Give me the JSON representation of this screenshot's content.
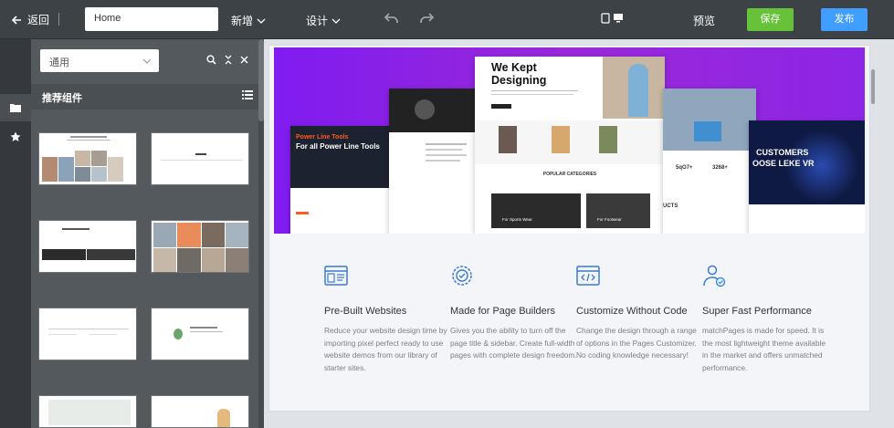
{
  "topbar": {
    "back_label": "返回",
    "page_value": "Home",
    "menu_add": "新增",
    "menu_design": "设计",
    "preview": "预览",
    "save": "保存",
    "publish": "发布"
  },
  "panel": {
    "select_value": "通用",
    "heading": "推荐组件"
  },
  "hero": {
    "headline_line1": "We Kept",
    "headline_line2": "Designing",
    "card_left_title": "Power Line Tools",
    "card_left_sub": "For all Power Line Tools ",
    "popular": "POPULAR CATEGORIES",
    "cat1": "For Sports Wear",
    "cat2": "For Footwear",
    "right_big": "CUSTOMERS",
    "right_big2": "OOSE LEKE VR",
    "stat1": "5qO7+",
    "stat2": "3268+",
    "ucts": "UCTS"
  },
  "features": [
    {
      "title": "Pre-Built Websites",
      "desc": "Reduce your website design time by importing pixel perfect ready to use website demos from our library of starter sites."
    },
    {
      "title": "Made for Page Builders",
      "desc": "Gives you the ability to turn off  the page title & sidebar. Create full-width pages with complete design freedom."
    },
    {
      "title": "Customize Without Code",
      "desc": "Change the design through a range of options in the Pages Customizer. No coding knowledge necessary!"
    },
    {
      "title": "Super Fast Performance",
      "desc": "matchPages is made for speed. It is the most lightweight theme available in the market and offers unmatched performance."
    }
  ],
  "colors": {
    "save_green": "#67c23a",
    "publish_blue": "#409eff",
    "hero_purple": "#8e26e6",
    "icon_blue": "#3a7bd5"
  }
}
